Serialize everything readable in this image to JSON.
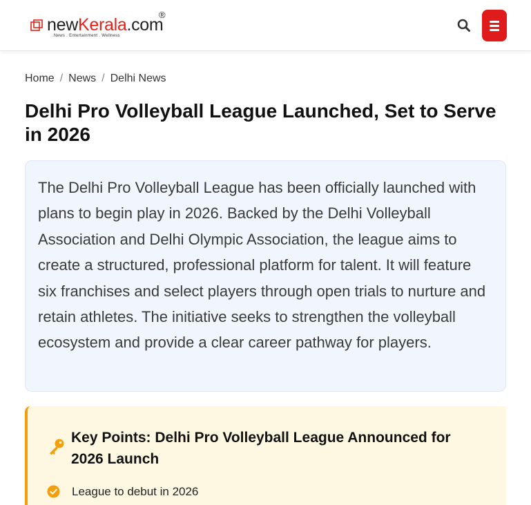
{
  "header": {
    "logo": {
      "text_prefix": "new",
      "text_brand": "Kerala",
      "text_suffix": ".com",
      "registered": "®",
      "tagline": ".News  . Entertainment  . Wellness"
    },
    "search_icon": "search-icon",
    "menu_icon": "hamburger-menu-icon",
    "accent_color": "#e01b1b"
  },
  "breadcrumb": {
    "items": [
      "Home",
      "News",
      "Delhi News"
    ],
    "separator": "/"
  },
  "article": {
    "title": "Delhi Pro Volleyball League Launched, Set to Serve in 2026",
    "summary": "The Delhi Pro Volleyball League has been officially launched with plans to begin play in 2026. Backed by the Delhi Volleyball Association and Delhi Olympic Association, the league aims to create a structured, professional platform for talent. It will feature six franchises and select players through open trials to nurture and retain athletes. The initiative seeks to strengthen the volleyball ecosystem and provide a clear career pathway for players."
  },
  "key_points": {
    "icon": "key-icon",
    "title": "Key Points: Delhi Pro Volleyball League Announced for 2026 Launch",
    "items": [
      {
        "icon": "check-circle-icon",
        "text": "League to debut in 2026"
      }
    ],
    "accent_color": "#f59e0b"
  }
}
